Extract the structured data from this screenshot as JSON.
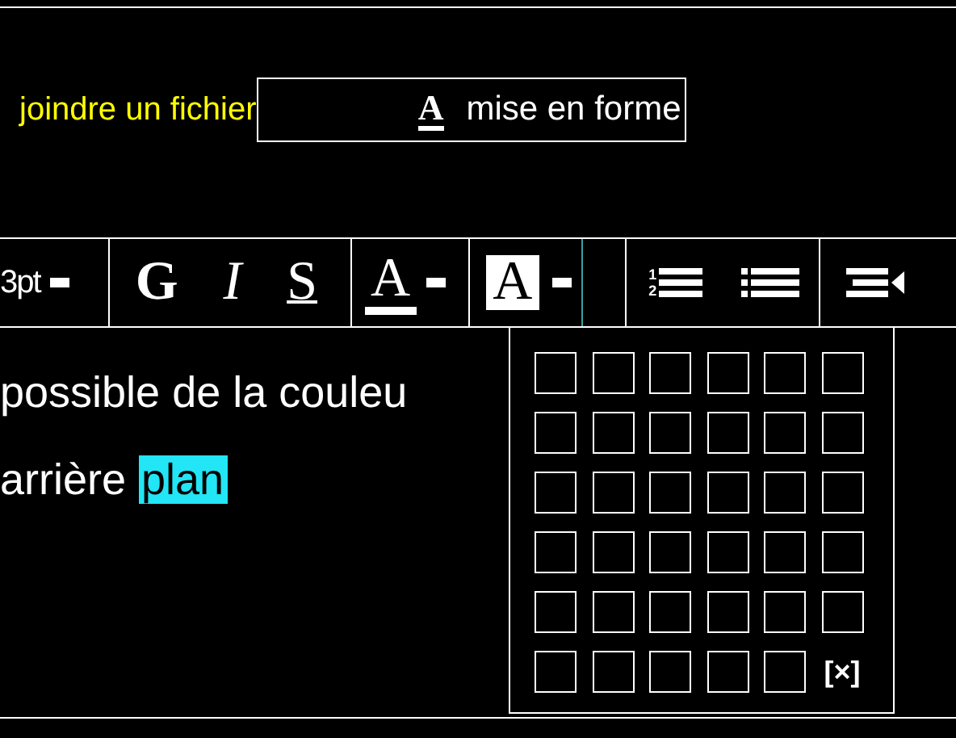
{
  "links": {
    "attach": "joindre un fichier",
    "format": {
      "label": "mise en forme",
      "icon_letter": "A"
    }
  },
  "toolbar": {
    "font_size": "3pt",
    "styles": [
      {
        "kind": "bold",
        "label": "G"
      },
      {
        "kind": "italic",
        "label": "I"
      },
      {
        "kind": "underline",
        "label": "S"
      }
    ],
    "colors": [
      {
        "kind": "text-color",
        "label": "A",
        "selected": false
      },
      {
        "kind": "highlight",
        "label": "A",
        "selected": true
      }
    ]
  },
  "lists": [
    {
      "kind": "numbered",
      "markers": [
        "1",
        "2"
      ]
    },
    {
      "kind": "bulleted"
    }
  ],
  "editor": {
    "lines": [
      [
        {
          "text": "possible de la couleu"
        }
      ],
      [
        {
          "text": "arrière "
        },
        {
          "text": "plan",
          "color": "#22e5f5"
        }
      ]
    ]
  },
  "palette": {
    "swatches": [
      {
        "kind": "swatch"
      },
      {
        "kind": "swatch"
      },
      {
        "kind": "swatch"
      },
      {
        "kind": "swatch"
      },
      {
        "kind": "swatch"
      },
      {
        "kind": "swatch"
      },
      {
        "kind": "swatch"
      },
      {
        "kind": "swatch"
      },
      {
        "kind": "swatch"
      },
      {
        "kind": "swatch"
      },
      {
        "kind": "swatch"
      },
      {
        "kind": "swatch"
      },
      {
        "kind": "swatch"
      },
      {
        "kind": "swatch"
      },
      {
        "kind": "swatch"
      },
      {
        "kind": "swatch"
      },
      {
        "kind": "swatch"
      },
      {
        "kind": "swatch"
      },
      {
        "kind": "swatch"
      },
      {
        "kind": "swatch"
      },
      {
        "kind": "swatch"
      },
      {
        "kind": "swatch"
      },
      {
        "kind": "swatch"
      },
      {
        "kind": "swatch"
      },
      {
        "kind": "swatch"
      },
      {
        "kind": "swatch"
      },
      {
        "kind": "swatch"
      },
      {
        "kind": "swatch"
      },
      {
        "kind": "swatch"
      },
      {
        "kind": "swatch"
      },
      {
        "kind": "swatch"
      },
      {
        "kind": "swatch"
      },
      {
        "kind": "swatch"
      },
      {
        "kind": "swatch"
      },
      {
        "kind": "swatch"
      },
      {
        "kind": "clear",
        "label": "[×]"
      }
    ]
  }
}
